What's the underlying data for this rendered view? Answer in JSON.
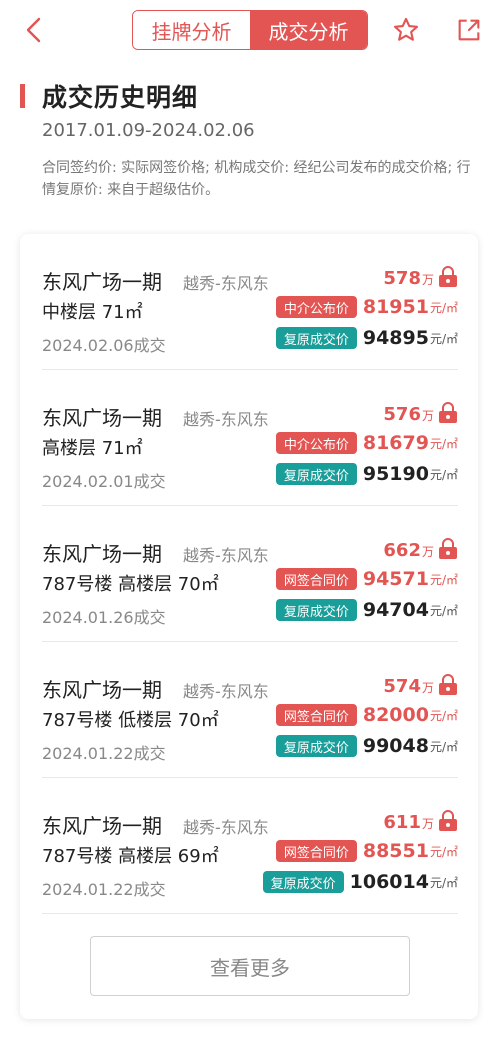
{
  "header": {
    "tabs": [
      {
        "label": "挂牌分析",
        "active": false
      },
      {
        "label": "成交分析",
        "active": true
      }
    ],
    "accent": "#e25553",
    "icons": [
      "back-icon",
      "star-icon",
      "share-icon"
    ]
  },
  "section": {
    "title": "成交历史明细",
    "date_range": "2017.01.09-2024.02.06",
    "description": "合同签约价: 实际网签价格; 机构成交价: 经纪公司发布的成交价格; 行情复原价: 来自于超级估价。"
  },
  "records": [
    {
      "name": "东风广场一期",
      "area": "越秀-东风东",
      "total": "578",
      "total_unit": "万",
      "floor": "中楼层 71㎡",
      "tag1": "中介公布价",
      "value1": "81951",
      "tag2": "复原成交价",
      "value2": "94895",
      "unit": "元/㎡",
      "date": "2024.02.06成交"
    },
    {
      "name": "东风广场一期",
      "area": "越秀-东风东",
      "total": "576",
      "total_unit": "万",
      "floor": "高楼层 71㎡",
      "tag1": "中介公布价",
      "value1": "81679",
      "tag2": "复原成交价",
      "value2": "95190",
      "unit": "元/㎡",
      "date": "2024.02.01成交"
    },
    {
      "name": "东风广场一期",
      "area": "越秀-东风东",
      "total": "662",
      "total_unit": "万",
      "floor": "787号楼 高楼层 70㎡",
      "tag1": "网签合同价",
      "value1": "94571",
      "tag2": "复原成交价",
      "value2": "94704",
      "unit": "元/㎡",
      "date": "2024.01.26成交"
    },
    {
      "name": "东风广场一期",
      "area": "越秀-东风东",
      "total": "574",
      "total_unit": "万",
      "floor": "787号楼 低楼层 70㎡",
      "tag1": "网签合同价",
      "value1": "82000",
      "tag2": "复原成交价",
      "value2": "99048",
      "unit": "元/㎡",
      "date": "2024.01.22成交"
    },
    {
      "name": "东风广场一期",
      "area": "越秀-东风东",
      "total": "611",
      "total_unit": "万",
      "floor": "787号楼 高楼层 69㎡",
      "tag1": "网签合同价",
      "value1": "88551",
      "tag2": "复原成交价",
      "value2": "106014",
      "unit": "元/㎡",
      "date": "2024.01.22成交"
    }
  ],
  "more_button": "查看更多"
}
